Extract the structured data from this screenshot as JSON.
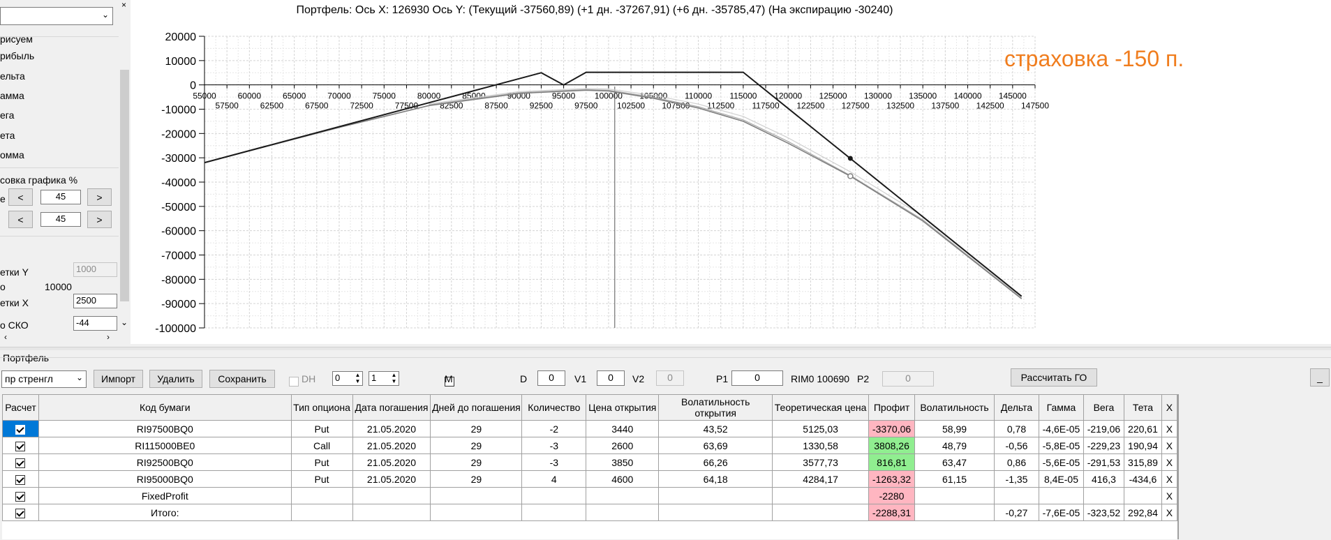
{
  "left_panel": {
    "draw_label": "рисуем",
    "options": [
      "рибыль",
      "ельта",
      "амма",
      "ега",
      "ета",
      "омма"
    ],
    "scale_group": "совка графика %",
    "row1_label": "е",
    "row1_value": "45",
    "row2_label": "",
    "row2_value": "45",
    "prev": "<",
    "next": ">",
    "grid_y_label": "етки Y",
    "grid_y_value": "1000",
    "to_label": "о",
    "to_value": "10000",
    "grid_x_label": "етки X",
    "grid_x_value": "2500",
    "sko_label": "о СКО",
    "sko_value": "-44"
  },
  "chart": {
    "title": "Портфель: Ось X: 126930 Ось Y:  (Текущий -37560,89)  (+1 дн. -37267,91)  (+6 дн. -35785,47)  (На экспирацию -30240)",
    "annotation": "страховка -150 п.",
    "colors": {
      "expiry": "#1a1a1a",
      "current": "#808080",
      "plus1": "#a8a8a8",
      "plus6": "#cfcfcf",
      "annotation": "#f07d1e",
      "cursor": "#555555"
    },
    "y_ticks": [
      "20000",
      "10000",
      "0",
      "-10000",
      "-20000",
      "-30000",
      "-40000",
      "-50000",
      "-60000",
      "-70000",
      "-80000",
      "-90000",
      "-100000"
    ],
    "x_ticks_upper": [
      "55000",
      "60000",
      "65000",
      "70000",
      "75000",
      "80000",
      "85000",
      "90000",
      "95000",
      "100000",
      "105000",
      "110000",
      "115000",
      "120000",
      "125000",
      "130000",
      "135000",
      "140000",
      "145000"
    ],
    "x_ticks_lower": [
      "57500",
      "62500",
      "67500",
      "72500",
      "77500",
      "82500",
      "87500",
      "92500",
      "97500",
      "102500",
      "107500",
      "112500",
      "117500",
      "122500",
      "127500",
      "132500",
      "137500",
      "142500",
      "147500"
    ]
  },
  "chart_data": {
    "type": "line",
    "title": "Портфель: Ось X: 126930 Ось Y:  (Текущий -37560,89)  (+1 дн. -37267,91)  (+6 дн. -35785,47)  (На экспирацию -30240)",
    "xlim": [
      55000,
      147500
    ],
    "ylim": [
      -100000,
      20000
    ],
    "grid": true,
    "cursor_x": 100690,
    "marker_x": 126930,
    "series": [
      {
        "name": "На экспирацию",
        "x": [
          55000,
          92500,
          95000,
          97500,
          115000,
          146000
        ],
        "y": [
          -32000,
          5000,
          0,
          5200,
          5200,
          -87000
        ]
      },
      {
        "name": "Текущий",
        "x": [
          55000,
          70000,
          80000,
          90000,
          97500,
          100000,
          105000,
          110000,
          115000,
          120000,
          126930,
          135000,
          146000
        ],
        "y": [
          -32000,
          -17500,
          -8500,
          -3500,
          -2200,
          -2500,
          -5500,
          -9500,
          -15000,
          -24000,
          -37561,
          -56000,
          -88000
        ]
      },
      {
        "name": "+1 дн.",
        "x": [
          80000,
          90000,
          97500,
          100000,
          105000,
          110000,
          115000,
          120000,
          126930,
          135000,
          146000
        ],
        "y": [
          -8200,
          -3200,
          -1900,
          -2200,
          -5100,
          -9000,
          -14400,
          -23300,
          -37268,
          -55500,
          -87700
        ]
      },
      {
        "name": "+6 дн.",
        "x": [
          80000,
          90000,
          97500,
          100000,
          105000,
          110000,
          115000,
          120000,
          126930,
          135000,
          146000
        ],
        "y": [
          -7800,
          -2800,
          -1500,
          -1700,
          -4300,
          -7900,
          -13000,
          -21800,
          -35785,
          -54000,
          -87000
        ]
      }
    ]
  },
  "portfolio": {
    "group_label": "Портфель",
    "strategy": "пр стренгл",
    "import_label": "Импорт",
    "delete_label": "Удалить",
    "save_label": "Сохранить",
    "dh_label": "DH",
    "spin1": "0",
    "spin2": "1",
    "m_label": "M",
    "d_label": "D",
    "d_value": "0",
    "v1_label": "V1",
    "v1_value": "0",
    "v2_label": "V2",
    "v2_value": "0",
    "p1_label": "P1",
    "p1_value": "0",
    "rim_label": "RIM0 100690",
    "p2_label": "P2",
    "p2_value": "0",
    "calc_go_label": "Рассчитать ГО",
    "minimize_label": "_"
  },
  "table": {
    "headers": [
      "Расчет",
      "Код бумаги",
      "Тип опциона",
      "Дата погашения",
      "Дней до погашения",
      "Количество",
      "Цена открытия",
      "Волатильность открытия",
      "Теоретическая цена",
      "Профит",
      "Волатильность",
      "Дельта",
      "Гамма",
      "Вега",
      "Тета",
      "X"
    ],
    "rows": [
      {
        "code": "RI97500BQ0",
        "type": "Put",
        "date": "21.05.2020",
        "days": "29",
        "qty": "-2",
        "open": "3440",
        "vol_open": "43,52",
        "theo": "5125,03",
        "profit": "-3370,06",
        "profit_state": "red",
        "vol": "58,99",
        "delta": "0,78",
        "gamma": "-4,6E-05",
        "vega": "-219,06",
        "theta": "220,61",
        "x": "X"
      },
      {
        "code": "RI115000BE0",
        "type": "Call",
        "date": "21.05.2020",
        "days": "29",
        "qty": "-3",
        "open": "2600",
        "vol_open": "63,69",
        "theo": "1330,58",
        "profit": "3808,26",
        "profit_state": "green",
        "vol": "48,79",
        "delta": "-0,56",
        "gamma": "-5,8E-05",
        "vega": "-229,23",
        "theta": "190,94",
        "x": "X"
      },
      {
        "code": "RI92500BQ0",
        "type": "Put",
        "date": "21.05.2020",
        "days": "29",
        "qty": "-3",
        "open": "3850",
        "vol_open": "66,26",
        "theo": "3577,73",
        "profit": "816,81",
        "profit_state": "green",
        "vol": "63,47",
        "delta": "0,86",
        "gamma": "-5,6E-05",
        "vega": "-291,53",
        "theta": "315,89",
        "x": "X"
      },
      {
        "code": "RI95000BQ0",
        "type": "Put",
        "date": "21.05.2020",
        "days": "29",
        "qty": "4",
        "open": "4600",
        "vol_open": "64,18",
        "theo": "4284,17",
        "profit": "-1263,32",
        "profit_state": "red",
        "vol": "61,15",
        "delta": "-1,35",
        "gamma": "8,4E-05",
        "vega": "416,3",
        "theta": "-434,6",
        "x": "X"
      },
      {
        "code": "FixedProfit",
        "type": "",
        "date": "",
        "days": "",
        "qty": "",
        "open": "",
        "vol_open": "",
        "theo": "",
        "profit": "-2280",
        "profit_state": "red",
        "vol": "",
        "delta": "",
        "gamma": "",
        "vega": "",
        "theta": "",
        "x": "X"
      },
      {
        "code": "Итого:",
        "type": "",
        "date": "",
        "days": "",
        "qty": "",
        "open": "",
        "vol_open": "",
        "theo": "",
        "profit": "-2288,31",
        "profit_state": "red",
        "vol": "",
        "delta": "-0,27",
        "gamma": "-7,6E-05",
        "vega": "-323,52",
        "theta": "292,84",
        "x": "X"
      }
    ]
  }
}
